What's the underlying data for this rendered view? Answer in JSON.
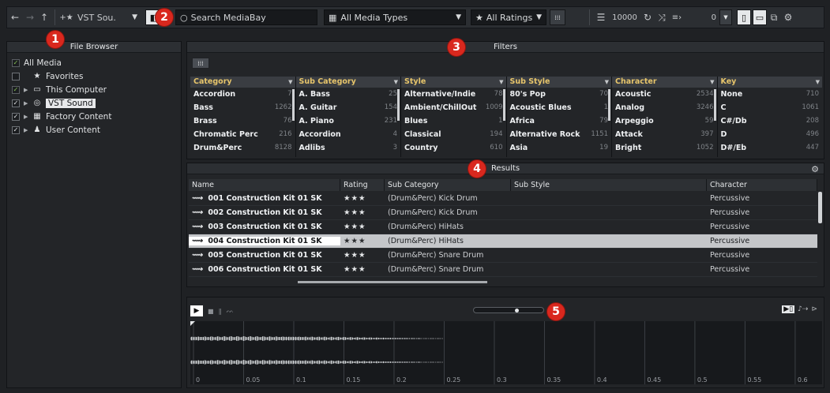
{
  "toolbar": {
    "vst_sound_label": "VST Sou.",
    "search_placeholder": "Search MediaBay",
    "media_types": "All Media Types",
    "ratings": "All Ratings",
    "result_count": "10000",
    "zero_value": "0"
  },
  "callouts": [
    "1",
    "2",
    "3",
    "4",
    "5"
  ],
  "file_browser": {
    "title": "File Browser",
    "items": [
      {
        "label": "All Media"
      },
      {
        "label": "Favorites",
        "icon": "star-icon"
      },
      {
        "label": "This Computer",
        "icon": "monitor-icon"
      },
      {
        "label": "VST Sound",
        "icon": "disc-icon"
      },
      {
        "label": "Factory Content",
        "icon": "grid-icon"
      },
      {
        "label": "User Content",
        "icon": "user-icon"
      }
    ]
  },
  "filters": {
    "title": "Filters",
    "columns": [
      {
        "header": "Category",
        "rows": [
          [
            "Accordion",
            "7"
          ],
          [
            "Bass",
            "1262"
          ],
          [
            "Brass",
            "76"
          ],
          [
            "Chromatic Perc",
            "216"
          ],
          [
            "Drum&Perc",
            "8128"
          ]
        ]
      },
      {
        "header": "Sub Category",
        "rows": [
          [
            "A. Bass",
            "25"
          ],
          [
            "A. Guitar",
            "154"
          ],
          [
            "A. Piano",
            "231"
          ],
          [
            "Accordion",
            "4"
          ],
          [
            "Adlibs",
            "3"
          ]
        ]
      },
      {
        "header": "Style",
        "rows": [
          [
            "Alternative/Indie",
            "78"
          ],
          [
            "Ambient/ChillOut",
            "1009"
          ],
          [
            "Blues",
            "1"
          ],
          [
            "Classical",
            "194"
          ],
          [
            "Country",
            "610"
          ]
        ]
      },
      {
        "header": "Sub Style",
        "rows": [
          [
            "80's Pop",
            "70"
          ],
          [
            "Acoustic Blues",
            "1"
          ],
          [
            "Africa",
            "79"
          ],
          [
            "Alternative Rock",
            "1151"
          ],
          [
            "Asia",
            "19"
          ]
        ]
      },
      {
        "header": "Character",
        "rows": [
          [
            "Acoustic",
            "2534"
          ],
          [
            "Analog",
            "3246"
          ],
          [
            "Arpeggio",
            "59"
          ],
          [
            "Attack",
            "397"
          ],
          [
            "Bright",
            "1052"
          ]
        ]
      },
      {
        "header": "Key",
        "rows": [
          [
            "None",
            "710"
          ],
          [
            "C",
            "1061"
          ],
          [
            "C#/Db",
            "208"
          ],
          [
            "D",
            "496"
          ],
          [
            "D#/Eb",
            "447"
          ]
        ]
      }
    ]
  },
  "results": {
    "title": "Results",
    "headers": [
      "Name",
      "Rating",
      "Sub Category",
      "Sub Style",
      "Character"
    ],
    "rows": [
      {
        "name": "001 Construction Kit 01 SK",
        "rating": "★★★",
        "sub": "(Drum&Perc) Kick Drum",
        "style": "",
        "character": "Percussive"
      },
      {
        "name": "002 Construction Kit 01 SK",
        "rating": "★★★",
        "sub": "(Drum&Perc) Kick Drum",
        "style": "",
        "character": "Percussive"
      },
      {
        "name": "003 Construction Kit 01 SK",
        "rating": "★★★",
        "sub": "(Drum&Perc) HiHats",
        "style": "",
        "character": "Percussive"
      },
      {
        "name": "004 Construction Kit 01 SK",
        "rating": "★★★",
        "sub": "(Drum&Perc) HiHats",
        "style": "",
        "character": "Percussive"
      },
      {
        "name": "005 Construction Kit 01 SK",
        "rating": "★★★",
        "sub": "(Drum&Perc) Snare Drum",
        "style": "",
        "character": "Percussive"
      },
      {
        "name": "006 Construction Kit 01 SK",
        "rating": "★★★",
        "sub": "(Drum&Perc) Snare Drum",
        "style": "",
        "character": "Percussive"
      }
    ],
    "selected_index": 3
  },
  "previewer": {
    "ticks": [
      "0",
      "0.05",
      "0.1",
      "0.15",
      "0.2",
      "0.25",
      "0.3",
      "0.35",
      "0.4",
      "0.45",
      "0.5",
      "0.55",
      "0.6"
    ]
  },
  "colors": {
    "callout": "#d9281e",
    "category_header": "#e7c56b",
    "selected_row": "#c4c6c9"
  }
}
